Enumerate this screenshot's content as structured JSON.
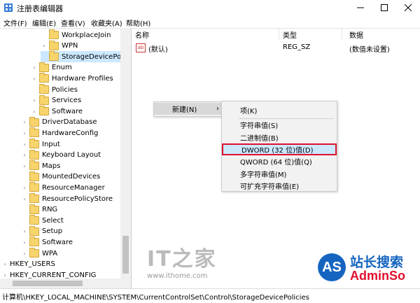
{
  "window": {
    "title": "注册表编辑器"
  },
  "menu": [
    "文件(F)",
    "编辑(E)",
    "查看(V)",
    "收藏夹(A)",
    "帮助(H)"
  ],
  "tree": [
    {
      "label": "WorkplaceJoin",
      "indent": 4
    },
    {
      "label": "WPN",
      "indent": 4,
      "expandable": true
    },
    {
      "label": "StorageDevicePolicies",
      "indent": 4,
      "selected": true
    },
    {
      "label": "Enum",
      "indent": 3,
      "expandable": true
    },
    {
      "label": "Hardware Profiles",
      "indent": 3,
      "expandable": true
    },
    {
      "label": "Policies",
      "indent": 3
    },
    {
      "label": "Services",
      "indent": 3,
      "expandable": true
    },
    {
      "label": "Software",
      "indent": 3,
      "expandable": true
    },
    {
      "label": "DriverDatabase",
      "indent": 2,
      "expandable": true
    },
    {
      "label": "HardwareConfig",
      "indent": 2,
      "expandable": true
    },
    {
      "label": "Input",
      "indent": 2,
      "expandable": true
    },
    {
      "label": "Keyboard Layout",
      "indent": 2,
      "expandable": true
    },
    {
      "label": "Maps",
      "indent": 2,
      "expandable": true
    },
    {
      "label": "MountedDevices",
      "indent": 2
    },
    {
      "label": "ResourceManager",
      "indent": 2,
      "expandable": true
    },
    {
      "label": "ResourcePolicyStore",
      "indent": 2,
      "expandable": true
    },
    {
      "label": "RNG",
      "indent": 2
    },
    {
      "label": "Select",
      "indent": 2
    },
    {
      "label": "Setup",
      "indent": 2,
      "expandable": true
    },
    {
      "label": "Software",
      "indent": 2,
      "expandable": true
    },
    {
      "label": "WPA",
      "indent": 2,
      "expandable": true
    },
    {
      "label": "HKEY_USERS",
      "indent": 0,
      "expandable": true
    },
    {
      "label": "HKEY_CURRENT_CONFIG",
      "indent": 0,
      "expandable": true
    }
  ],
  "columns": {
    "name": "名称",
    "type": "类型",
    "data": "数据"
  },
  "values": [
    {
      "icon": "ab",
      "name": "(默认)",
      "type": "REG_SZ",
      "data": "(数值未设置)"
    }
  ],
  "context_menu": {
    "new_label": "新建(N)",
    "arrow": "›"
  },
  "submenu": [
    {
      "label": "项(K)"
    },
    {
      "label": "字符串值(S)"
    },
    {
      "label": "二进制值(B)"
    },
    {
      "label": "DWORD (32 位)值(D)",
      "highlighted": true
    },
    {
      "label": "QWORD (64 位)值(Q)"
    },
    {
      "label": "多字符串值(M)"
    },
    {
      "label": "可扩充字符串值(E)"
    }
  ],
  "status": "计算机\\HKEY_LOCAL_MACHINE\\SYSTEM\\CurrentControlSet\\Control\\StorageDevicePolicies",
  "watermark": {
    "ithome_logo": "IT之家",
    "ithome_url": "www.ithome.com",
    "adminso_badge": "AS",
    "adminso_cn": "站长搜索",
    "adminso_en": "AdminSo"
  },
  "colors": {
    "selection": "#cce8ff",
    "highlight_border": "#e0102e",
    "accent_blue": "#1565c0"
  }
}
